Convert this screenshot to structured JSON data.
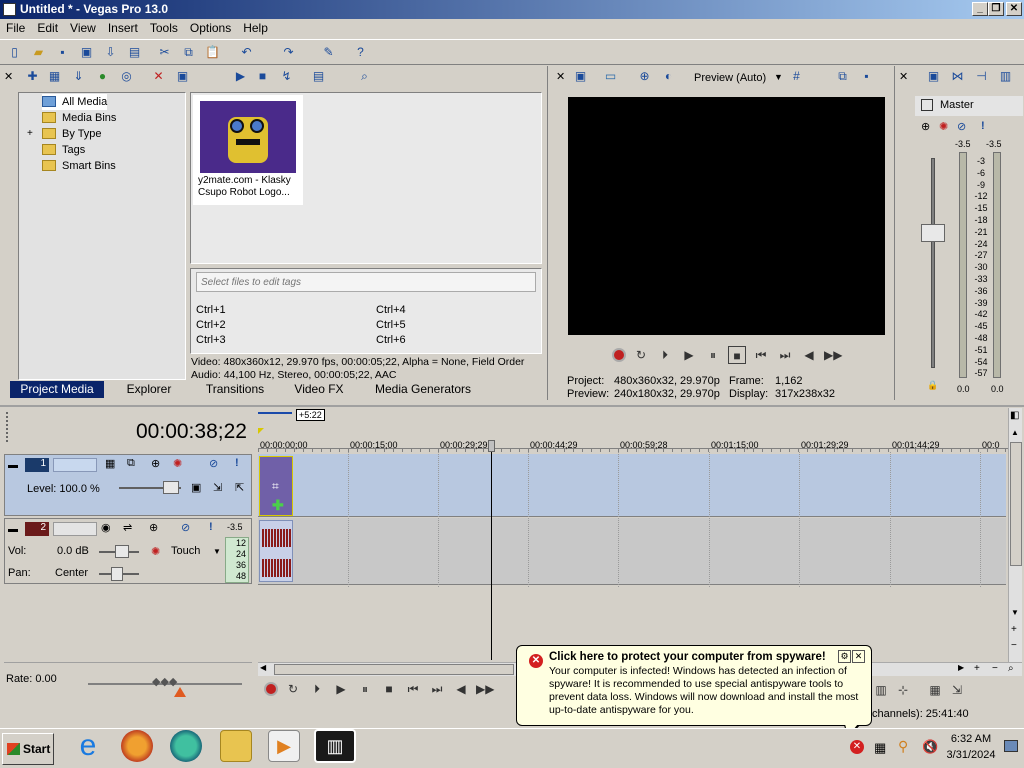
{
  "window": {
    "title": "Untitled * - Vegas Pro 13.0"
  },
  "menu": [
    "File",
    "Edit",
    "View",
    "Insert",
    "Tools",
    "Options",
    "Help"
  ],
  "media_tree": [
    "All Media",
    "Media Bins",
    "By Type",
    "Tags",
    "Smart Bins"
  ],
  "media_item": {
    "name": "y2mate.com - Klasky Csupo Robot Logo..."
  },
  "tags": {
    "placeholder": "Select files to edit tags",
    "shortcuts": [
      "Ctrl+1",
      "Ctrl+2",
      "Ctrl+3",
      "Ctrl+4",
      "Ctrl+5",
      "Ctrl+6"
    ]
  },
  "media_info": {
    "video": "Video: 480x360x12, 29.970 fps, 00:00:05;22, Alpha = None, Field Order",
    "audio": "Audio: 44,100 Hz, Stereo, 00:00:05;22, AAC"
  },
  "tabs": [
    "Project Media",
    "Explorer",
    "Transitions",
    "Video FX",
    "Media Generators"
  ],
  "preview": {
    "mode": "Preview (Auto)",
    "project_label": "Project:",
    "project_value": "480x360x32, 29.970p",
    "preview_label": "Preview:",
    "preview_value": "240x180x32, 29.970p",
    "frame_label": "Frame:",
    "frame_value": "1,162",
    "display_label": "Display:",
    "display_value": "317x238x32"
  },
  "master": {
    "label": "Master",
    "peak_left": "-3.5",
    "peak_right": "-3.5",
    "scale": [
      "3",
      "6",
      "9",
      "12",
      "15",
      "18",
      "21",
      "24",
      "27",
      "30",
      "33",
      "36",
      "39",
      "42",
      "45",
      "48",
      "51",
      "54",
      "57"
    ],
    "bottom_left": "0.0",
    "bottom_right": "0.0"
  },
  "timeline": {
    "time": "00:00:38;22",
    "marker": "+5:22",
    "ticks": [
      "00:00:00;00",
      "00:00:15;00",
      "00:00:29;29",
      "00:00:44;29",
      "00:00:59;28",
      "00:01:15;00",
      "00:01:29;29",
      "00:01:44;29",
      "00:0"
    ]
  },
  "track1": {
    "number": "1",
    "level": "Level: 100.0 %"
  },
  "track2": {
    "number": "2",
    "vol_label": "Vol:",
    "vol_value": "0.0 dB",
    "pan_label": "Pan:",
    "pan_value": "Center",
    "mode": "Touch",
    "meter_top": "-3.5",
    "meter_scale": [
      "12",
      "24",
      "36",
      "48"
    ]
  },
  "rate": "Rate: 0.00",
  "status": "channels): 25:41:40",
  "popup": {
    "title": "Click here to protect your computer from spyware!",
    "body": "Your computer is infected! Windows has detected an infection of spyware! It is recommended to use special antispyware tools to prevent data loss. Windows will now download and install the most up-to-date antispyware for you."
  },
  "taskbar": {
    "start": "Start",
    "time": "6:32 AM",
    "date": "3/31/2024"
  },
  "colors": {
    "title_start": "#0a246a",
    "popup_bg": "#ffffe1",
    "error": "#d32020",
    "track_video": "#b8c8e0"
  }
}
